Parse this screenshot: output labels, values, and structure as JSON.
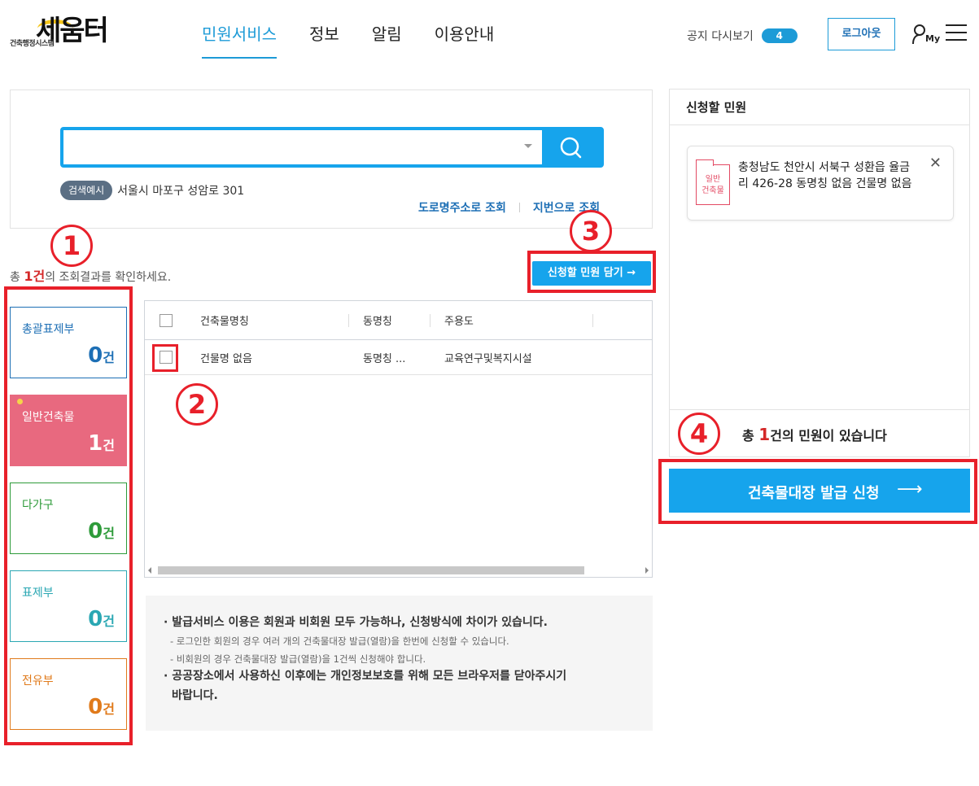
{
  "header": {
    "logo_small": "건축행정시스템",
    "logo_big": "세움터",
    "nav": [
      "민원서비스",
      "정보",
      "알림",
      "이용안내"
    ],
    "notice_label": "공지 다시보기",
    "notice_count": "4",
    "logout_label": "로그아웃",
    "my_label": "My"
  },
  "search": {
    "placeholder": "",
    "example_badge": "검색예시",
    "example_text": "서울시 마포구 성암로 301",
    "road_lookup": "도로명주소로 조회",
    "lot_lookup": "지번으로 조회"
  },
  "result": {
    "prefix": "총 ",
    "count": "1건",
    "suffix": "의 조회결과를 확인하세요.",
    "cart_button": "신청할 민원 담기 →"
  },
  "categories": [
    {
      "name": "총괄표제부",
      "count": "0",
      "unit": "건",
      "color": "#1d6fb5"
    },
    {
      "name": "일반건축물",
      "count": "1",
      "unit": "건",
      "color": "#e8697f"
    },
    {
      "name": "다가구",
      "count": "0",
      "unit": "건",
      "color": "#2e9b3a"
    },
    {
      "name": "표제부",
      "count": "0",
      "unit": "건",
      "color": "#2aa7b3"
    },
    {
      "name": "전유부",
      "count": "0",
      "unit": "건",
      "color": "#e07a1b"
    }
  ],
  "table": {
    "headers": [
      "건축물명칭",
      "동명칭",
      "주용도"
    ],
    "rows": [
      [
        "건물명 없음",
        "동명칭 ...",
        "교육연구및복지시설"
      ]
    ]
  },
  "info": {
    "line1": "· 발급서비스 이용은 회원과 비회원 모두 가능하나, 신청방식에 차이가 있습니다.",
    "sub1": "- 로그인한 회원의 경우 여러 개의 건축물대장 발급(열람)을 한번에 신청할 수 있습니다.",
    "sub2": "- 비회원의 경우 건축물대장 발급(열람)을 1건씩 신청해야 합니다.",
    "line2a": "· 공공장소에서 사용하신 이후에는 개인정보보호를 위해 모든 브라우저를 닫아주시기",
    "line2b": "바랍니다."
  },
  "apply": {
    "title": "신청할 민원",
    "tag_line1": "일반",
    "tag_line2": "건축물",
    "item_text": "충청남도 천안시 서북구 성환읍 율금리 426-28 동명칭 없음 건물명 없음",
    "close": "✕",
    "total_prefix": "총 ",
    "total_count": "1",
    "total_suffix": "건의 민원이 있습니다",
    "issue_button": "건축물대장 발급 신청",
    "issue_arrow": "⟶"
  },
  "annotations": {
    "n1": "1",
    "n2": "2",
    "n3": "3",
    "n4": "4"
  },
  "colors": {
    "accent": "#16a4ec",
    "highlight": "#e8202a"
  }
}
